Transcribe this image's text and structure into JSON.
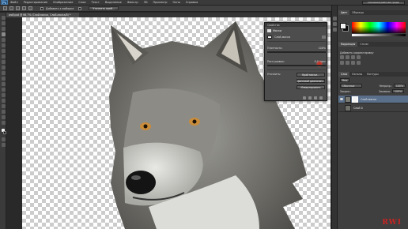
{
  "app": {
    "logo": "Ps"
  },
  "menu": [
    "Файл",
    "Редактирование",
    "Изображение",
    "Слои",
    "Текст",
    "Выделение",
    "Фильтр",
    "3D",
    "Просмотр",
    "Окно",
    "Справка"
  ],
  "workspace": "Основная рабочая среда",
  "options": {
    "refine_edge": "Уточнить край...",
    "add_to_sample": "Добавить к выборке"
  },
  "document_tab": "wolf.psd @ 66,7% (Слой-маска, Слой-маска/8) *",
  "right_panels": {
    "color_tabs": [
      "Цвет",
      "Образцы"
    ],
    "adjustments_tabs": [
      "Коррекция",
      "Стили"
    ],
    "adjustments_title": "Добавить корректировку",
    "layers_tabs": [
      "Слои",
      "Каналы",
      "Контуры"
    ],
    "filter_kind": "Вид",
    "blend_mode": "Обычные",
    "opacity_label": "Непрозр.:",
    "opacity_value": "100%",
    "lock_label": "Закреп.:",
    "fill_label": "Заливка:",
    "fill_value": "100%",
    "layers": [
      {
        "name": "Слой-маска",
        "selected": true,
        "has_mask": true
      },
      {
        "name": "Слой 0",
        "selected": false,
        "has_mask": false
      }
    ]
  },
  "properties_dialog": {
    "title": "Свойства",
    "header": "Маски",
    "mask_label": "Слой-маска",
    "density_label": "Плотность:",
    "density_value": "100%",
    "feather_label": "Растушевка:",
    "feather_value": "0,0 пикс",
    "refine_label": "Уточнить:",
    "buttons": [
      "Край маски...",
      "Цветовой диапазон...",
      "Инвертировать"
    ]
  },
  "watermark": "RWI",
  "colors": {
    "bg_dark": "#262626",
    "panel": "#3f3f3f",
    "selected_layer": "#5a6f8a",
    "ps_blue": "#20507a"
  }
}
